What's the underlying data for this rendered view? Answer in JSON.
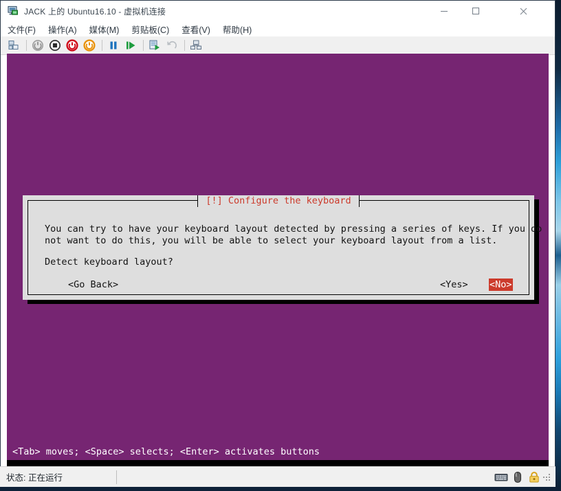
{
  "window": {
    "title": "JACK 上的 Ubuntu16.10 - 虚拟机连接",
    "icon": "virtual-machine-icon",
    "controls": {
      "minimize": "—",
      "maximize": "▢",
      "close": "✕"
    }
  },
  "menubar": {
    "items": [
      {
        "label": "文件(F)"
      },
      {
        "label": "操作(A)"
      },
      {
        "label": "媒体(M)"
      },
      {
        "label": "剪贴板(C)"
      },
      {
        "label": "查看(V)"
      },
      {
        "label": "帮助(H)"
      }
    ]
  },
  "toolbar": {
    "items": [
      {
        "name": "checkpoint-icon"
      },
      {
        "name": "separator"
      },
      {
        "name": "shutdown-icon"
      },
      {
        "name": "turn-off-icon"
      },
      {
        "name": "power-off-icon"
      },
      {
        "name": "reset-icon"
      },
      {
        "name": "separator"
      },
      {
        "name": "pause-icon"
      },
      {
        "name": "start-icon"
      },
      {
        "name": "separator"
      },
      {
        "name": "revert-snapshot-icon"
      },
      {
        "name": "undo-icon"
      },
      {
        "name": "separator"
      },
      {
        "name": "enhanced-session-icon"
      }
    ]
  },
  "vm_screen": {
    "background_color": "#762572",
    "dialog": {
      "title": "[!] Configure the keyboard",
      "title_color": "#cc3b2c",
      "background_color": "#dedede",
      "paragraph_line1": "You can try to have your keyboard layout detected by pressing a series of keys. If you do",
      "paragraph_line2": "not want to do this, you will be able to select your keyboard layout from a list.",
      "question": "Detect keyboard layout?",
      "buttons": [
        {
          "label": "<Go Back>",
          "selected": false
        },
        {
          "label": "<Yes>",
          "selected": false
        },
        {
          "label": "<No>",
          "selected": true,
          "highlight_color": "#cc3b2c"
        }
      ]
    },
    "help_line": "<Tab> moves; <Space> selects; <Enter> activates buttons"
  },
  "statusbar": {
    "status": "状态: 正在运行",
    "icons": [
      {
        "name": "keyboard-icon"
      },
      {
        "name": "mouse-icon"
      },
      {
        "name": "lock-icon"
      }
    ]
  }
}
